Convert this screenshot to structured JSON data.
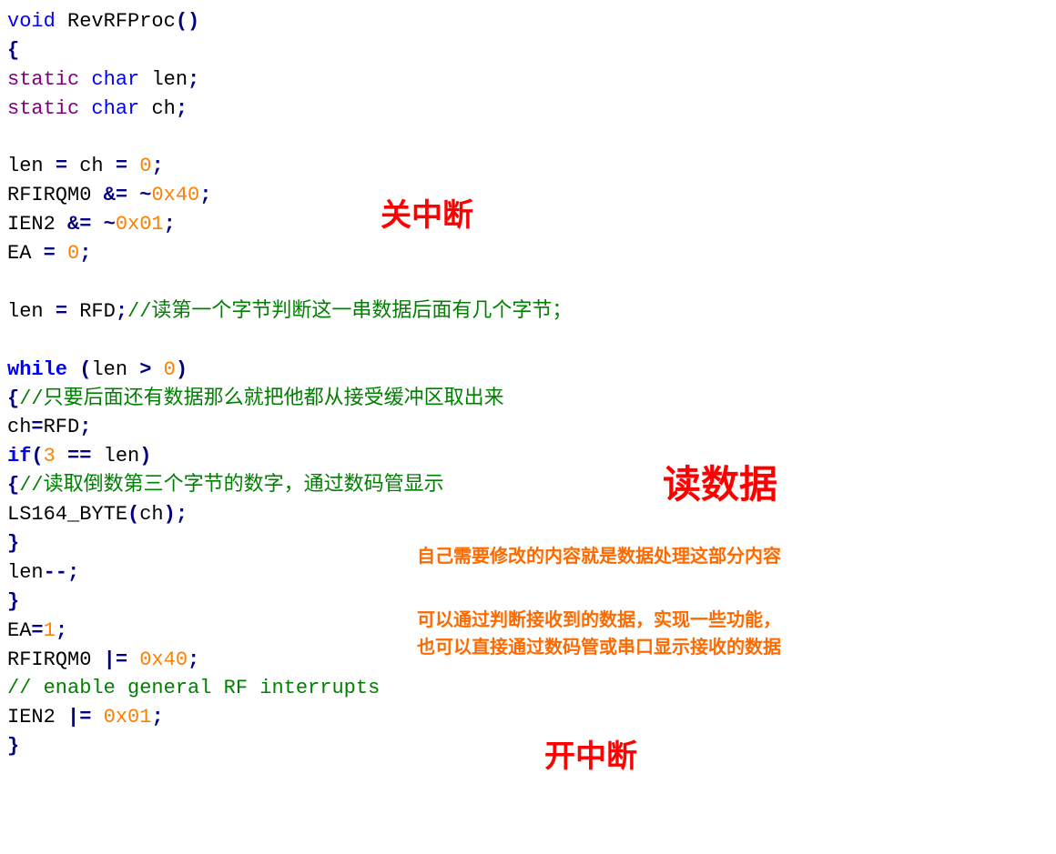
{
  "code": {
    "l1": {
      "void": "void",
      "fn": "RevRFProc",
      "lp": "(",
      "rp": ")"
    },
    "l2": {
      "brace": "{"
    },
    "l3": {
      "static": "static",
      "char": "char",
      "id": "len",
      "sc": ";"
    },
    "l4": {
      "static": "static",
      "char": "char",
      "id": "ch",
      "sc": ";"
    },
    "l5": "",
    "l6": {
      "a": "len ",
      "op1": "=",
      "b": " ch ",
      "op2": "=",
      "sp": " ",
      "num": "0",
      "sc": ";"
    },
    "l7": {
      "a": "RFIRQM0 ",
      "op": "&=",
      "sp": " ",
      "tilde": "~",
      "num": "0x40",
      "sc": ";"
    },
    "l8": {
      "a": "IEN2 ",
      "op": "&=",
      "sp": " ",
      "tilde": "~",
      "num": "0x01",
      "sc": ";"
    },
    "l9": {
      "a": "EA ",
      "op": "=",
      "sp": " ",
      "num": "0",
      "sc": ";"
    },
    "l10": "",
    "l11": {
      "a": "len ",
      "op": "=",
      "b": " RFD",
      "sc": ";",
      "cmt": "//读第一个字节判断这一串数据后面有几个字节；"
    },
    "l12": "",
    "l13": {
      "while": "while",
      "lp": " (",
      "a": "len ",
      "op": ">",
      "sp": " ",
      "num": "0",
      "rp": ")"
    },
    "l14": {
      "brace": "{",
      "cmt": "//只要后面还有数据那么就把他都从接受缓冲区取出来"
    },
    "l15": {
      "a": "ch",
      "op": "=",
      "b": "RFD",
      "sc": ";"
    },
    "l16": {
      "if": "if",
      "lp": "(",
      "num": "3",
      "sp": " ",
      "op": "==",
      "sp2": " ",
      "a": "len",
      "rp": ")"
    },
    "l17": {
      "brace": "{",
      "cmt": "//读取倒数第三个字节的数字，通过数码管显示"
    },
    "l18": {
      "fn": "LS164_BYTE",
      "lp": "(",
      "a": "ch",
      "rp": ")",
      "sc": ";"
    },
    "l19": {
      "brace": "}"
    },
    "l20": {
      "a": "len",
      "op": "--",
      "sc": ";"
    },
    "l21": {
      "brace": "}"
    },
    "l22": {
      "a": "EA",
      "op": "=",
      "num": "1",
      "sc": ";"
    },
    "l23": {
      "a": "RFIRQM0 ",
      "op": "|=",
      "sp": " ",
      "num": "0x40",
      "sc": ";"
    },
    "l24": {
      "cmt": "// enable general RF interrupts"
    },
    "l25": {
      "a": "IEN2 ",
      "op": "|=",
      "sp": " ",
      "num": "0x01",
      "sc": ";"
    },
    "l26": {
      "brace": "}"
    }
  },
  "annotations": {
    "close_int": "关中断",
    "read_data": "读数据",
    "open_int": "开中断",
    "note1": "自己需要修改的内容就是数据处理这部分内容",
    "note2": "可以通过判断接收到的数据，实现一些功能，",
    "note3": "也可以直接通过数码管或串口显示接收的数据"
  }
}
